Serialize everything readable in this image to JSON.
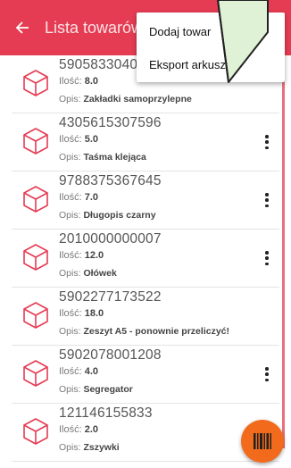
{
  "appbar": {
    "title": "Lista towarów",
    "back_icon": "arrow-left-icon"
  },
  "menu": {
    "items": [
      "Dodaj towar",
      "Eksport arkusza"
    ]
  },
  "list": {
    "qty_label": "Ilość:",
    "desc_label": "Opis:",
    "items": [
      {
        "code": "5905833040",
        "qty": "8.0",
        "desc": "Zakładki samoprzylepne"
      },
      {
        "code": "4305615307596",
        "qty": "5.0",
        "desc": "Taśma klejąca"
      },
      {
        "code": "9788375367645",
        "qty": "7.0",
        "desc": "Długopis czarny"
      },
      {
        "code": "2010000000007",
        "qty": "12.0",
        "desc": "Ołówek"
      },
      {
        "code": "5902277173522",
        "qty": "18.0",
        "desc": "Zeszyt A5 - ponownie przeliczyć!"
      },
      {
        "code": "5902078001208",
        "qty": "4.0",
        "desc": "Segregator"
      },
      {
        "code": "121146155833",
        "qty": "2.0",
        "desc": "Zszywki"
      }
    ]
  },
  "fab": {
    "icon": "barcode-icon"
  },
  "colors": {
    "accent": "#e53c53",
    "fab": "#f26a1b"
  }
}
